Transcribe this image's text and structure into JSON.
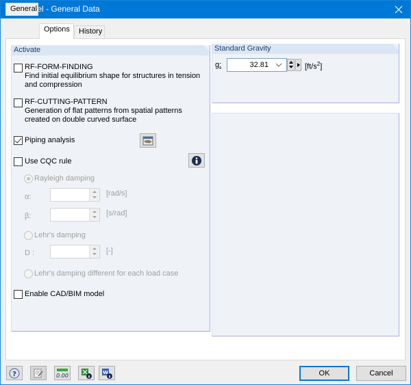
{
  "window": {
    "title": "Edit Model - General Data"
  },
  "tabs": [
    {
      "label": "General",
      "active": false
    },
    {
      "label": "Options",
      "active": true
    },
    {
      "label": "History",
      "active": false
    }
  ],
  "activate": {
    "header": "Activate",
    "form_finding": {
      "label": "RF-FORM-FINDING",
      "description": "Find initial equilibrium shape for structures in tension and compression",
      "checked": false
    },
    "cutting_pattern": {
      "label": "RF-CUTTING-PATTERN",
      "description": "Generation of flat patterns from spatial patterns created on double curved surface",
      "checked": false
    },
    "piping": {
      "label": "Piping analysis",
      "checked": true
    },
    "cqc": {
      "label": "Use CQC rule",
      "checked": false
    },
    "rayleigh": {
      "label": "Rayleigh damping",
      "selected": true
    },
    "alpha": {
      "label": "α:",
      "value": "",
      "unit": "[rad/s]"
    },
    "beta": {
      "label": "β:",
      "value": "",
      "unit": "[s/rad]"
    },
    "lehr": {
      "label": "Lehr's damping",
      "selected": false
    },
    "d": {
      "label": "D :",
      "value": "",
      "unit": "[-]"
    },
    "lehr_each": {
      "label": "Lehr's damping different for each load case",
      "selected": false
    },
    "cad_bim": {
      "label": "Enable CAD/BIM model",
      "checked": false
    }
  },
  "gravity": {
    "header": "Standard Gravity",
    "label": "g:",
    "value": "32.81",
    "unit_prefix": "[ft/s",
    "unit_exp": "2",
    "unit_suffix": "]"
  },
  "footer": {
    "ok": "OK",
    "cancel": "Cancel",
    "icons": [
      "help-icon",
      "edit-icon",
      "decimal-places-icon",
      "excel-info-icon",
      "word-info-icon"
    ],
    "decimal_label": "0.00"
  },
  "colors": {
    "titlebar": "#0078d7",
    "group_bg": "#eff2f7",
    "group_header": "#dbe6f4"
  }
}
